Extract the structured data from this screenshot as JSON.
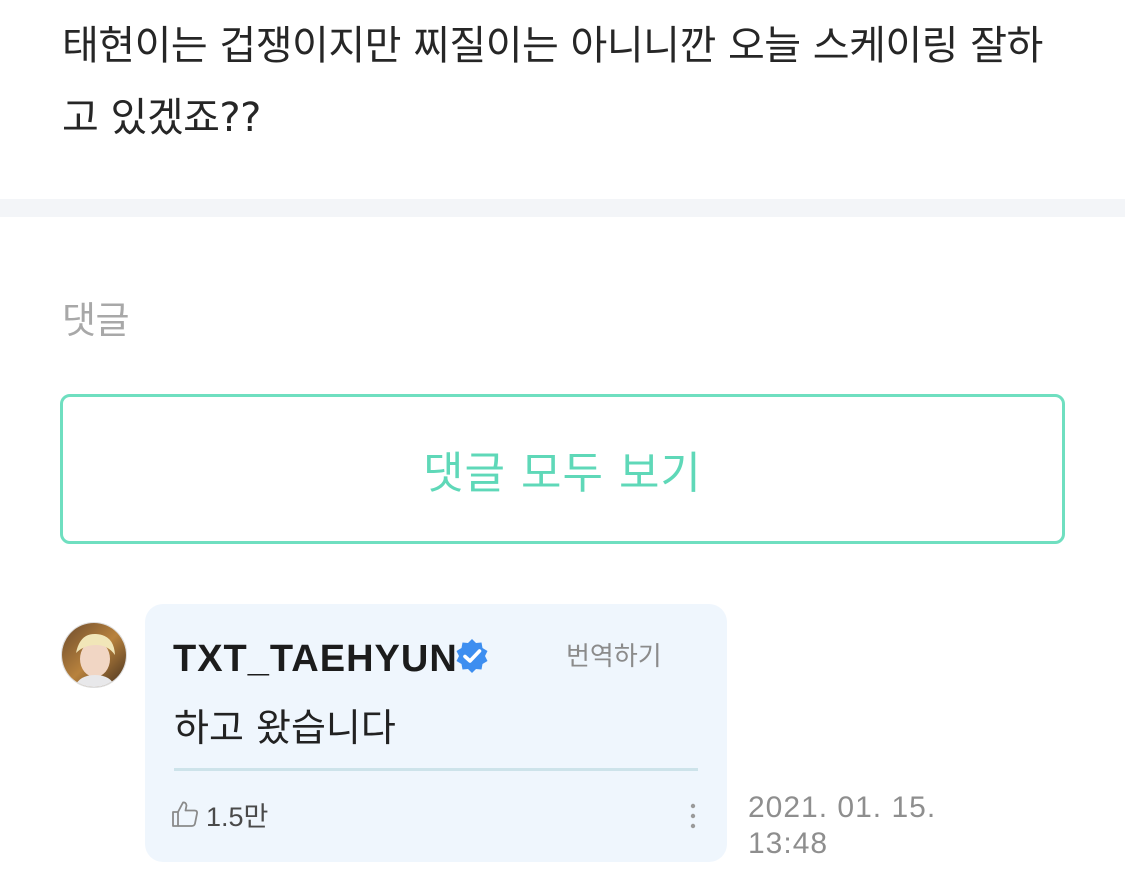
{
  "post": {
    "body": "태현이는 겁쟁이지만 찌질이는 아니니깐 오늘 스케이링 잘하고 있겠죠??"
  },
  "comments_section": {
    "heading": "댓글",
    "view_all_label": "댓글 모두 보기"
  },
  "comment": {
    "author": "TXT_TAEHYUN",
    "translate_label": "번역하기",
    "text": "하고 왔습니다",
    "likes": "1.5만",
    "date": "2021. 01. 15.",
    "time": "13:48"
  },
  "colors": {
    "accent": "#5fd8b8",
    "bubble": "#eff6fd",
    "verified": "#3d8ef0"
  },
  "icons": [
    "verified-badge-icon",
    "thumbs-up-icon",
    "more-vertical-icon"
  ]
}
